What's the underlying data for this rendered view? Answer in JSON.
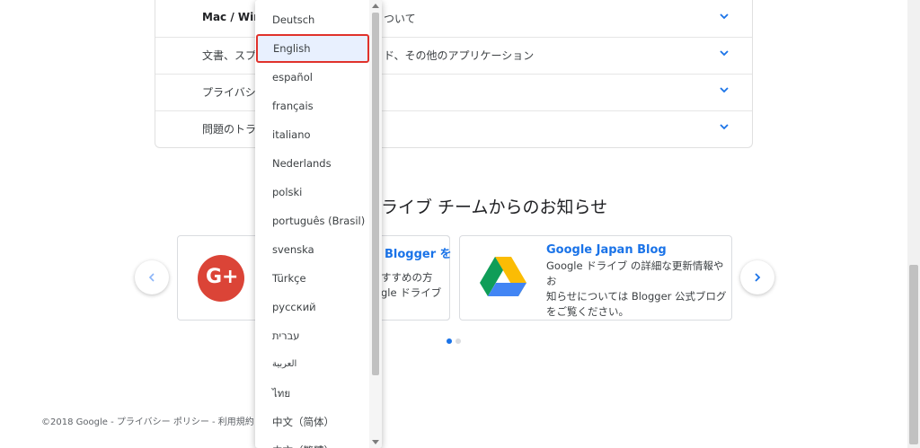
{
  "faq": [
    {
      "text": "Mac / Wind",
      "tail": "ついて",
      "bold": true
    },
    {
      "text": "文書、スプ",
      "tail": "ド、その他のアプリケーション",
      "bold": false
    },
    {
      "text": "プライバシー",
      "tail": "",
      "bold": false
    },
    {
      "text": "問題のトラ",
      "tail": "",
      "bold": false
    }
  ],
  "news": {
    "title": "ライブ チームからのお知らせ",
    "cards": [
      {
        "icon": "google-plus-icon",
        "title": "",
        "desc": ""
      },
      {
        "icon": "",
        "title": "Blogger を",
        "desc_lines": [
          "すすめの方",
          "gle ドライブ"
        ]
      },
      {
        "icon": "google-drive-icon",
        "title": "Google Japan Blog",
        "desc_lines": [
          "Google ドライブ の詳細な更新情報やお",
          "知らせについては Blogger 公式ブログ",
          "をご覧ください。"
        ]
      }
    ],
    "prev_icon": "chevron-left-icon",
    "next_icon": "chevron-right-icon"
  },
  "footer": "©2018 Google - プライバシー ポリシー - 利用規約",
  "language_menu": {
    "items": [
      "Deutsch",
      "English",
      "español",
      "français",
      "italiano",
      "Nederlands",
      "polski",
      "português (Brasil)",
      "svenska",
      "Türkçe",
      "русский",
      "עברית",
      "العربية",
      "ไทย",
      "中文（简体）",
      "中文（繁體）"
    ],
    "selected": "English"
  },
  "colors": {
    "accent": "#1a73e8",
    "highlight_border": "#e0322b",
    "gplus_red": "#db4437"
  }
}
